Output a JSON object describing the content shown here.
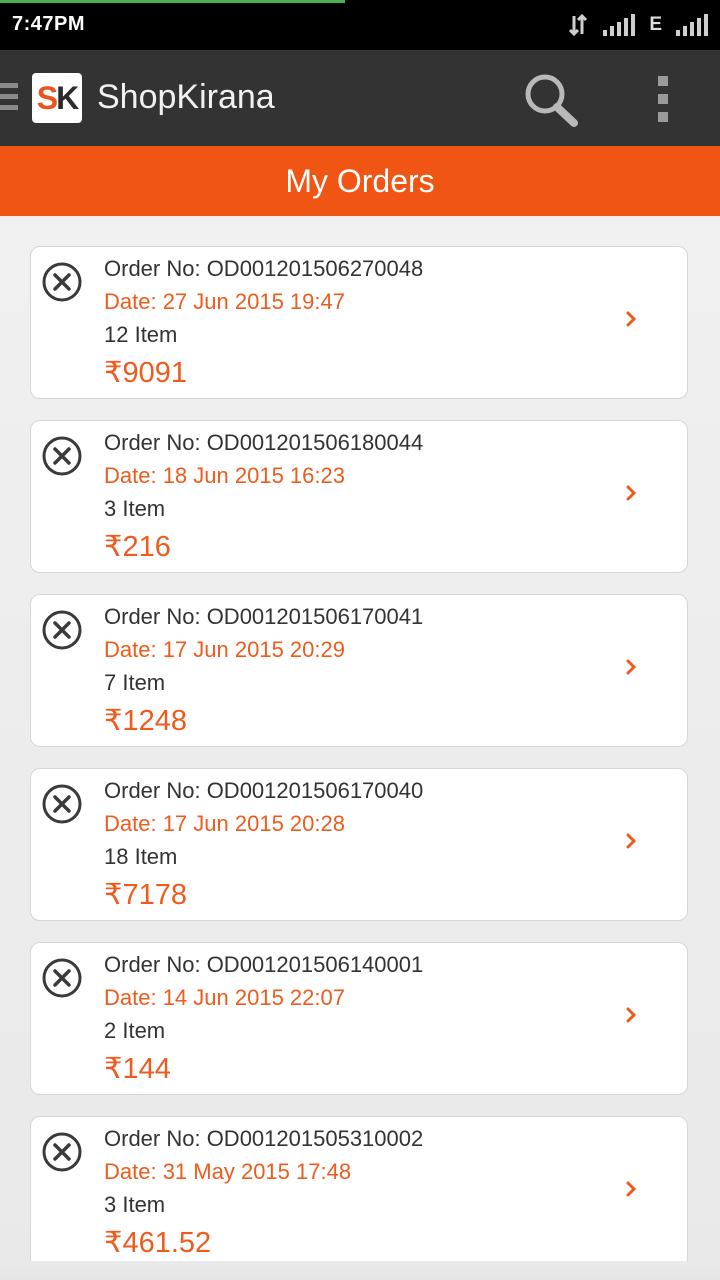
{
  "status_bar": {
    "time": "7:47PM",
    "network_label": "E"
  },
  "app_bar": {
    "logo_s": "S",
    "logo_k": "K",
    "title": "ShopKirana",
    "icons": [
      "menu-icon",
      "search-icon",
      "overflow-menu-icon"
    ]
  },
  "page": {
    "title": "My Orders"
  },
  "orders": [
    {
      "order_no": "Order No: OD001201506270048",
      "date": "Date: 27 Jun 2015 19:47",
      "items": "12 Item",
      "amount": "₹9091"
    },
    {
      "order_no": "Order No: OD001201506180044",
      "date": "Date: 18 Jun 2015 16:23",
      "items": "3 Item",
      "amount": "₹216"
    },
    {
      "order_no": "Order No: OD001201506170041",
      "date": "Date: 17 Jun 2015 20:29",
      "items": "7 Item",
      "amount": "₹1248"
    },
    {
      "order_no": "Order No: OD001201506170040",
      "date": "Date: 17 Jun 2015 20:28",
      "items": "18 Item",
      "amount": "₹7178"
    },
    {
      "order_no": "Order No: OD001201506140001",
      "date": "Date: 14 Jun 2015 22:07",
      "items": "2 Item",
      "amount": "₹144"
    },
    {
      "order_no": "Order No: OD001201505310002",
      "date": "Date: 31 May 2015 17:48",
      "items": "3 Item",
      "amount": "₹461.52"
    }
  ],
  "colors": {
    "accent": "#f05514",
    "appbar": "#333333",
    "statusbar": "#000000"
  }
}
